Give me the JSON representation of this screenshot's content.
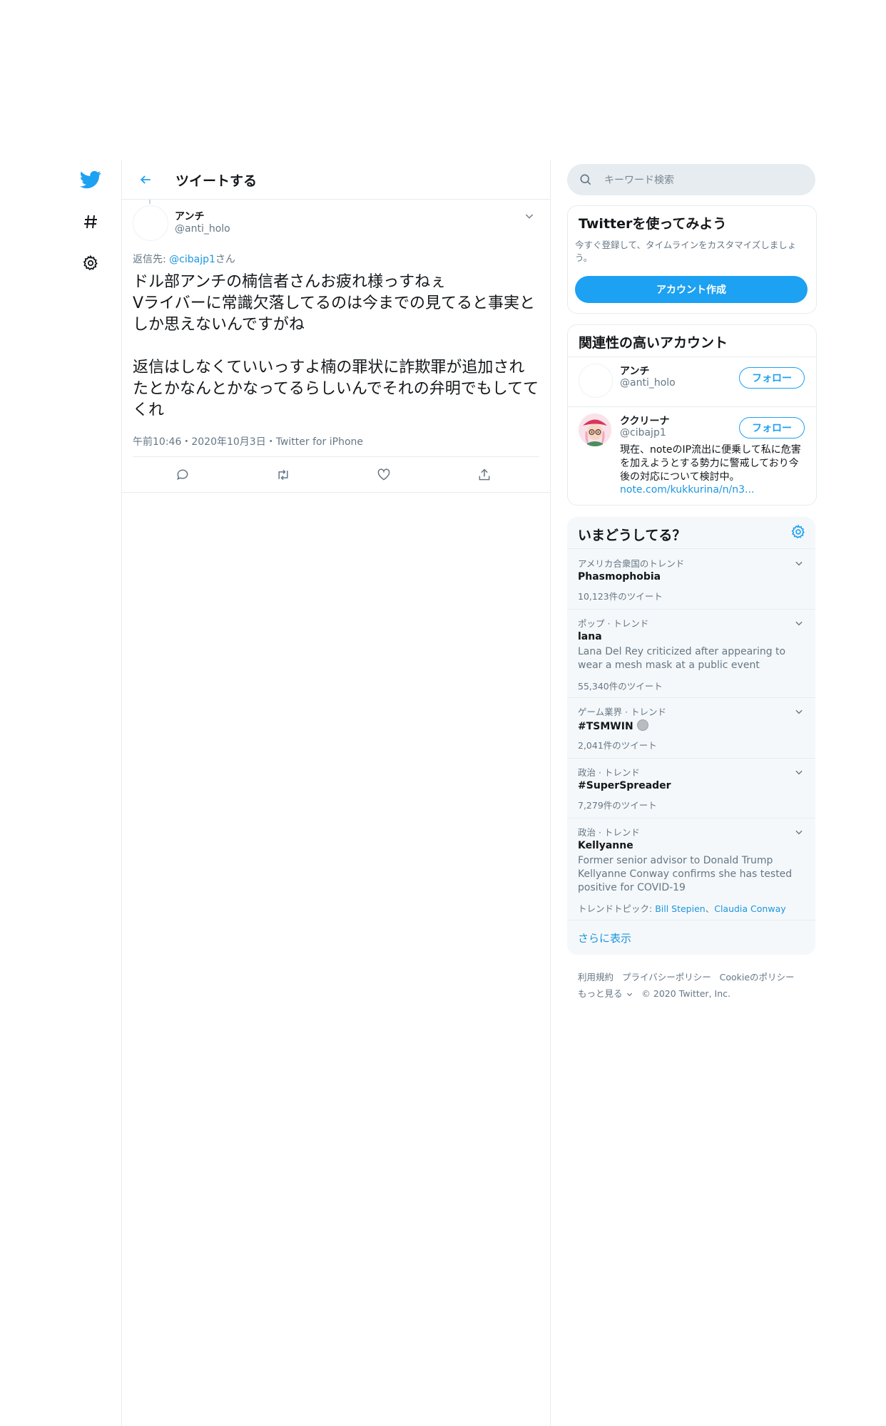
{
  "header": {
    "title": "ツイートする"
  },
  "tweet": {
    "author_name": "アンチ",
    "author_handle": "@anti_holo",
    "reply_prefix": "返信先: ",
    "reply_handle": "@cibajp1",
    "reply_suffix": "さん",
    "text": "ドル部アンチの楠信者さんお疲れ様っすねぇ\nVライバーに常識欠落してるのは今までの見てると事実としか思えないんですがね\n\n返信はしなくていいっすよ楠の罪状に詐欺罪が追加されたとかなんとかなってるらしいんでそれの弁明でもしててくれ",
    "meta": "午前10:46・2020年10月3日・Twitter for iPhone"
  },
  "search": {
    "placeholder": "キーワード検索"
  },
  "signup_card": {
    "title": "Twitterを使ってみよう",
    "description": "今すぐ登録して、タイムラインをカスタマイズしましょう。",
    "button": "アカウント作成"
  },
  "related": {
    "title": "関連性の高いアカウント",
    "accounts": [
      {
        "name": "アンチ",
        "handle": "@anti_holo",
        "follow": "フォロー"
      },
      {
        "name": "ククリーナ",
        "handle": "@cibajp1",
        "follow": "フォロー",
        "bio": "現在、noteのIP流出に便乗して私に危害を加えようとする勢力に警戒しており今後の対応について検討中。",
        "link": "note.com/kukkurina/n/n3..."
      }
    ]
  },
  "trends": {
    "title": "いまどうしてる？",
    "items": [
      {
        "context": "アメリカ合衆国のトレンド",
        "name": "Phasmophobia",
        "count": "10,123件のツイート"
      },
      {
        "context": "ポップ · トレンド",
        "name": "lana",
        "description": "Lana Del Rey criticized after appearing to wear a mesh mask at a public event",
        "count": "55,340件のツイート"
      },
      {
        "context": "ゲーム業界 · トレンド",
        "name": "#TSMWIN",
        "count": "2,041件のツイート"
      },
      {
        "context": "政治 · トレンド",
        "name": "#SuperSpreader",
        "count": "7,279件のツイート"
      },
      {
        "context": "政治 · トレンド",
        "name": "Kellyanne",
        "description": "Former senior advisor to Donald Trump Kellyanne Conway confirms she has tested positive for COVID-19",
        "topic_label": "トレンドトピック: ",
        "topics": [
          "Bill Stepien",
          "Claudia Conway"
        ]
      }
    ],
    "show_more": "さらに表示"
  },
  "footer": {
    "links": [
      "利用規約",
      "プライバシーポリシー",
      "Cookieのポリシー"
    ],
    "more": "もっと見る",
    "copyright": "© 2020 Twitter, Inc."
  },
  "colors": {
    "accent": "#1da1f2",
    "link": "#1b95e0",
    "secondary_text": "#657786",
    "border": "#e6ecf0",
    "panel": "#f5f8fa"
  }
}
